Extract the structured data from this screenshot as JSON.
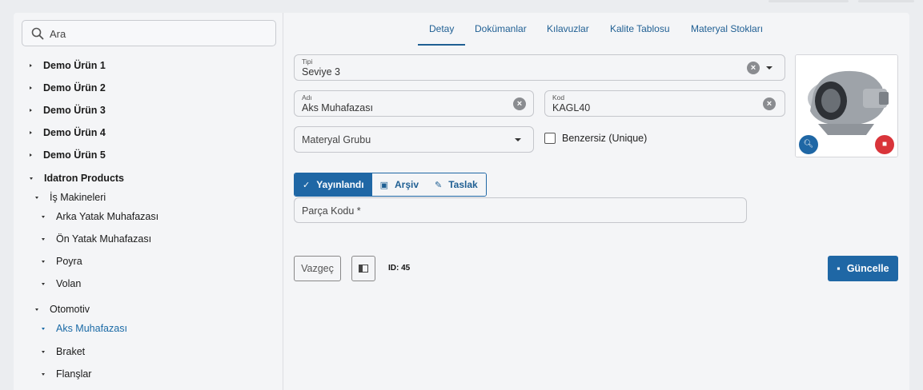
{
  "search": {
    "placeholder": "Ara"
  },
  "tree": [
    {
      "label": "Demo Ürün 1"
    },
    {
      "label": "Demo Ürün 2"
    },
    {
      "label": "Demo Ürün 3"
    },
    {
      "label": "Demo Ürün 4"
    },
    {
      "label": "Demo Ürün 5"
    },
    {
      "label": "Idatron Products"
    },
    {
      "label": "İş Makineleri"
    },
    {
      "label": "Arka Yatak Muhafazası"
    },
    {
      "label": "Ön Yatak Muhafazası"
    },
    {
      "label": "Poyra"
    },
    {
      "label": "Volan"
    },
    {
      "label": "Otomotiv"
    },
    {
      "label": "Aks Muhafazası"
    },
    {
      "label": "Braket"
    },
    {
      "label": "Flanşlar"
    }
  ],
  "tabs": [
    {
      "label": "Detay"
    },
    {
      "label": "Dokümanlar"
    },
    {
      "label": "Kılavuzlar"
    },
    {
      "label": "Kalite Tablosu"
    },
    {
      "label": "Materyal Stokları"
    }
  ],
  "form": {
    "tipi": {
      "label": "Tipi",
      "value": "Seviye 3"
    },
    "adi": {
      "label": "Adı",
      "value": "Aks Muhafazası"
    },
    "kod": {
      "label": "Kod",
      "value": "KAGL40"
    },
    "materyal_grubu": {
      "placeholder": "Materyal Grubu"
    },
    "unique_label": "Benzersiz (Unique)",
    "parca_kodu": {
      "placeholder": "Parça Kodu *"
    }
  },
  "status": [
    {
      "label": "Yayınlandı"
    },
    {
      "label": "Arşiv"
    },
    {
      "label": "Taslak"
    }
  ],
  "actions": {
    "cancel": "Vazgeç",
    "id_text": "ID: 45",
    "update": "Güncelle"
  },
  "colors": {
    "accent": "#1f67a5",
    "delete": "#d9343a"
  },
  "icons": {
    "search": "search-icon",
    "clear": "clear-icon",
    "zoom": "zoom-icon",
    "delete": "trash-icon",
    "save": "save-icon"
  }
}
